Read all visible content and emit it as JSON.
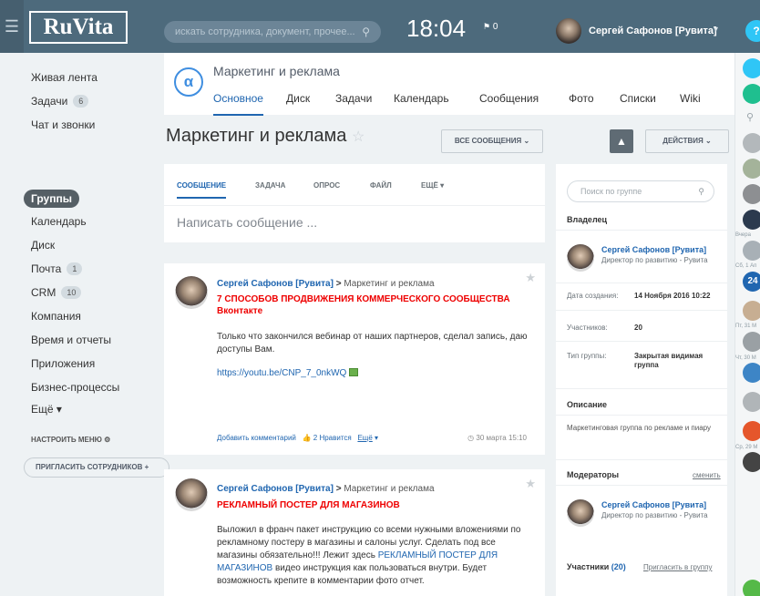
{
  "topbar": {
    "logo": "RuVita",
    "search_placeholder": "искать сотрудника, документ, прочее...",
    "clock": "18:04",
    "flag_count": "0",
    "user_name": "Сергей Сафонов [Рувита]",
    "help_label": "?"
  },
  "sidebar": {
    "items": [
      {
        "label": "Живая лента"
      },
      {
        "label": "Задачи",
        "badge": "6"
      },
      {
        "label": "Чат и звонки"
      },
      {
        "label": "Группы"
      },
      {
        "label": "Календарь"
      },
      {
        "label": "Диск"
      },
      {
        "label": "Почта",
        "badge": "1"
      },
      {
        "label": "CRM",
        "badge": "10"
      },
      {
        "label": "Компания"
      },
      {
        "label": "Время и отчеты"
      },
      {
        "label": "Приложения"
      },
      {
        "label": "Бизнес-процессы"
      },
      {
        "label": "Ещё ▾"
      }
    ],
    "configure": "НАСТРОИТЬ МЕНЮ",
    "invite": "ПРИГЛАСИТЬ СОТРУДНИКОВ"
  },
  "group": {
    "name": "Маркетинг и реклама",
    "tabs": [
      "Основное",
      "Диск",
      "Задачи",
      "Календарь",
      "Сообщения",
      "Фото",
      "Списки",
      "Wiki"
    ],
    "page_title": "Маркетинг и реклама",
    "all_messages": "ВСЕ СООБЩЕНИЯ",
    "actions": "ДЕЙСТВИЯ"
  },
  "composer": {
    "tabs": [
      "СООБЩЕНИЕ",
      "ЗАДАЧА",
      "ОПРОС",
      "ФАЙЛ",
      "ЕЩЁ ▾"
    ],
    "placeholder": "Написать сообщение ..."
  },
  "posts": [
    {
      "author": "Сергей Сафонов [Рувита]",
      "destination": "Маркетинг и реклама",
      "title": "7 СПОСОБОВ ПРОДВИЖЕНИЯ КОММЕРЧЕСКОГО СООБЩЕСТВА Вконтакте",
      "text": "Только что закончился вебинар от наших партнеров, сделал запись, даю доступы Вам.",
      "link": "https://youtu.be/CNP_7_0nkWQ",
      "add_comment": "Добавить комментарий",
      "likes": "2 Нравится",
      "more": "Ещё",
      "date": "30 марта 15:10"
    },
    {
      "author": "Сергей Сафонов [Рувита]",
      "destination": "Маркетинг и реклама",
      "title": "РЕКЛАМНЫЙ ПОСТЕР ДЛЯ МАГАЗИНОВ",
      "text_before": "Выложил в франч пакет инструкцию со всеми нужными вложениями по рекламному постеру в магазины и салоны услуг. Сделать под все магазины обязательно!!! Лежит здесь ",
      "text_link": "РЕКЛАМНЫЙ ПОСТЕР ДЛЯ МАГАЗИНОВ",
      "text_after": " видео инструкция как пользоваться внутри. Будет возможность крепите в комментарии фото отчет."
    }
  ],
  "panel": {
    "search_placeholder": "Поиск по группе",
    "owner_heading": "Владелец",
    "owner_name": "Сергей Сафонов [Рувита]",
    "owner_position": "Директор по развитию - Рувита",
    "created_label": "Дата создания:",
    "created_value": "14 Ноября 2016 10:22",
    "members_label": "Участников:",
    "members_value": "20",
    "type_label": "Тип группы:",
    "type_value": "Закрытая видимая группа",
    "description_heading": "Описание",
    "description": "Маркетинговая группа по рекламе и пиару",
    "moderators_heading": "Модераторы",
    "moderators_change": "сменить",
    "moderator_name": "Сергей Сафонов [Рувита]",
    "moderator_position": "Директор по развитию - Рувита",
    "participants_heading": "Участники",
    "participants_count": "(20)",
    "invite_link": "Пригласить в группу"
  },
  "rightstrip": {
    "labels": [
      "Вчера",
      "Сб, 1 Ап",
      "Пт, 31 М",
      "Чт, 30 М",
      "Ср, 29 М"
    ],
    "badge": "24"
  },
  "colors": {
    "accent": "#2066b0",
    "topbar": "#4d6a7c",
    "highlight": "#e00000"
  }
}
